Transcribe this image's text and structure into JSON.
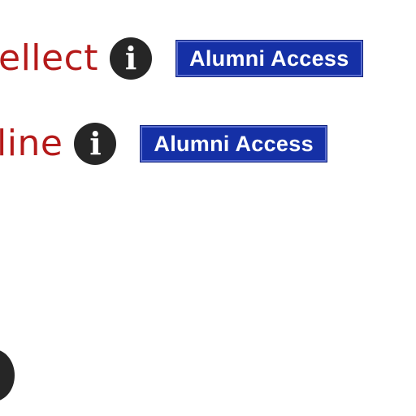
{
  "items": [
    {
      "title_fragment": "ellect",
      "info_icon": "info-icon",
      "badge": "Alumni Access"
    },
    {
      "title_fragment": "line",
      "info_icon": "info-icon",
      "badge": "Alumni Access"
    }
  ],
  "icons": {
    "info_glyph": "i"
  },
  "colors": {
    "link_text": "#b51a1a",
    "icon_bg": "#262626",
    "badge_bg": "#1530a6",
    "badge_text": "#ffffff"
  }
}
